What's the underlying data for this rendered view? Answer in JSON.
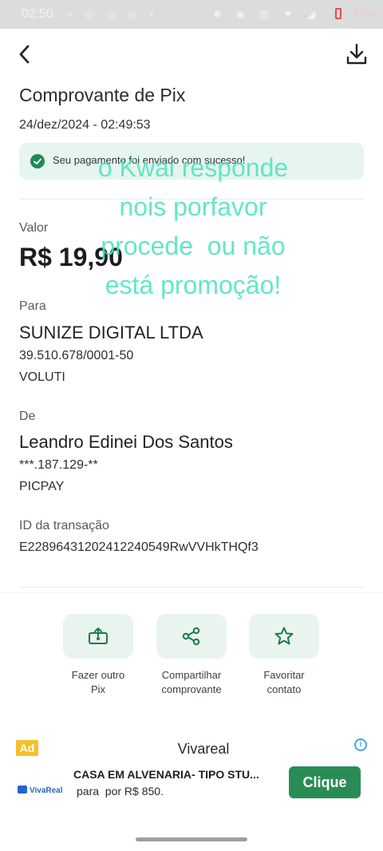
{
  "status_bar": {
    "time": "02:50",
    "left_icons": "≈ ◎ ◎ ◎ •",
    "right_icons": "✱ ◉ ▥ ▼ ◢",
    "battery_percent": "77%"
  },
  "header": {
    "back_icon": "chevron-left-icon",
    "download_icon": "download-icon"
  },
  "receipt": {
    "title": "Comprovante de Pix",
    "date": "24/dez/2024 - 02:49:53",
    "success_message": "Seu pagamento foi enviado com sucesso!",
    "amount_label": "Valor",
    "amount": "R$ 19,90",
    "to_label": "Para",
    "to_name": "SUNIZE DIGITAL LTDA",
    "to_document": "39.510.678/0001-50",
    "to_bank": "VOLUTI",
    "from_label": "De",
    "from_name": "Leandro Edinei Dos Santos",
    "from_document": "***.187.129-**",
    "from_bank": "PICPAY",
    "transaction_label": "ID da transação",
    "transaction_id": "E22896431202412240549RwVVHkTHQf3"
  },
  "actions": [
    {
      "label": "Fazer outro\nPix",
      "icon": "pix-transfer-icon"
    },
    {
      "label": "Compartilhar\ncomprovante",
      "icon": "share-icon"
    },
    {
      "label": "Favoritar\ncontato",
      "icon": "star-icon"
    }
  ],
  "ad": {
    "badge": "Ad",
    "brand": "Vivareal",
    "logo_text": "VivaReal",
    "headline": "CASA EM ALVENARIA- TIPO STU...",
    "subtext": "para  por R$ 850.",
    "cta": "Clique"
  },
  "overlay": {
    "text": "o Kwai responde\nnois porfavor\nprocede  ou não\nestá promoção!"
  },
  "colors": {
    "accent_green": "#1f8a56",
    "banner_bg": "#e6f5ee",
    "action_bg": "#eaf4ef",
    "overlay_text": "#4fe3c1",
    "ad_badge": "#f5c02a",
    "ad_cta": "#2a8c55"
  }
}
